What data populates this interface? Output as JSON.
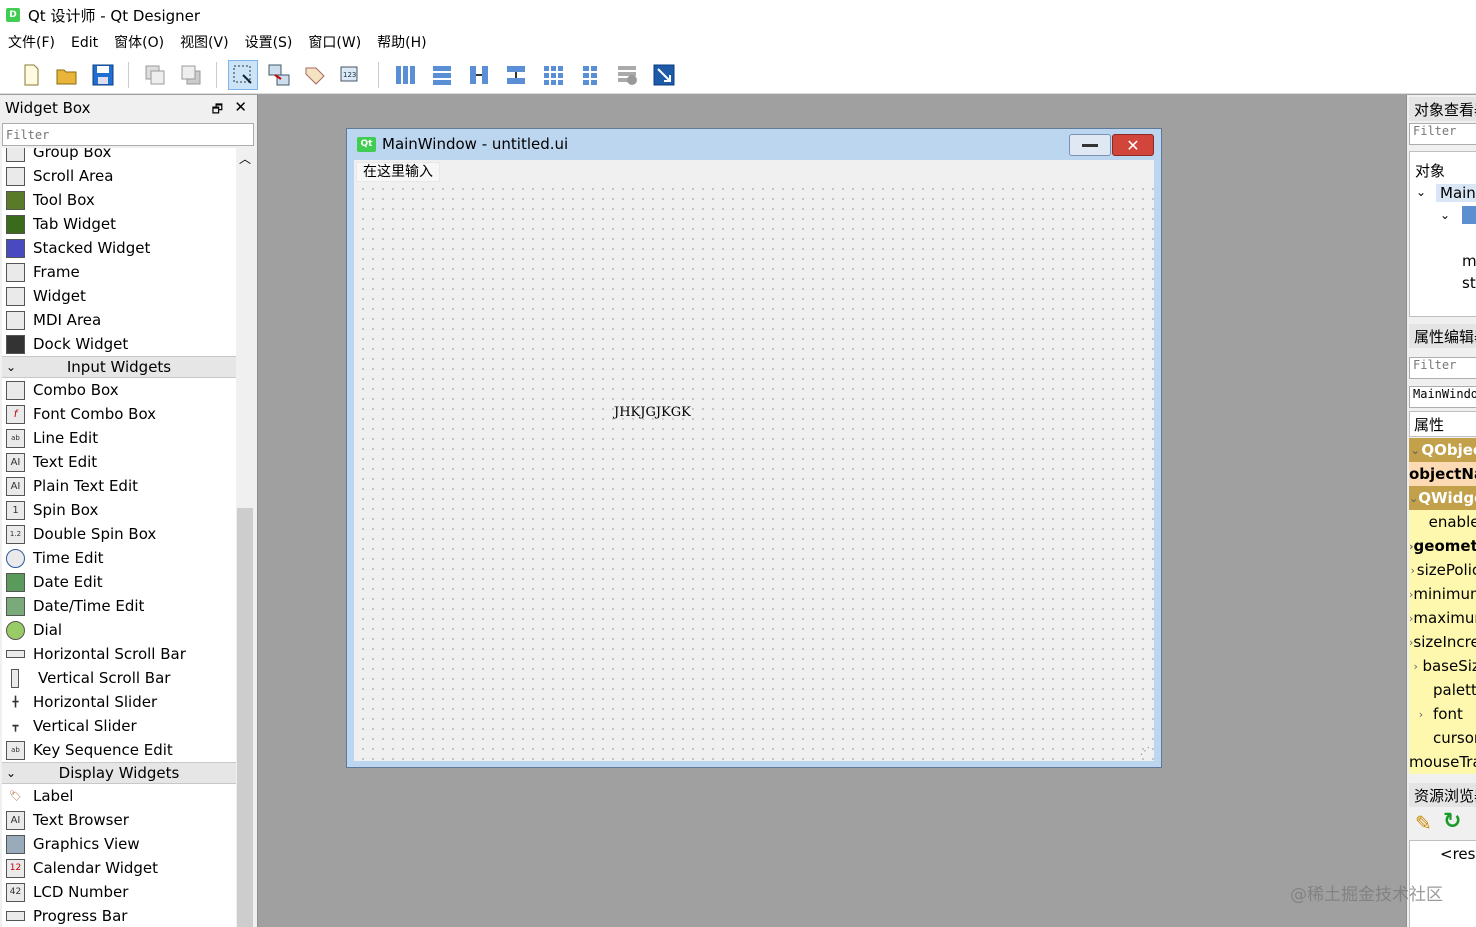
{
  "window": {
    "title": "Qt 设计师 - Qt Designer",
    "app_icon": "D"
  },
  "menubar": [
    "文件(F)",
    "Edit",
    "窗体(O)",
    "视图(V)",
    "设置(S)",
    "窗口(W)",
    "帮助(H)"
  ],
  "toolbar": {
    "icons": [
      "new-file-icon",
      "open-folder-icon",
      "save-icon",
      "send-to-back-icon",
      "bring-to-front-icon",
      "edit-widgets-icon",
      "edit-signals-slots-icon",
      "edit-buddies-icon",
      "edit-tab-order-icon",
      "layout-horizontal-icon",
      "layout-vertical-icon",
      "layout-horizontal-splitter-icon",
      "layout-vertical-splitter-icon",
      "layout-grid-icon",
      "layout-form-icon",
      "break-layout-icon",
      "adjust-size-icon"
    ],
    "active": "edit-widgets-icon"
  },
  "widget_box": {
    "title": "Widget Box",
    "filter_placeholder": "Filter",
    "items_top": [
      "Group Box",
      "Scroll Area",
      "Tool Box",
      "Tab Widget",
      "Stacked Widget",
      "Frame",
      "Widget",
      "MDI Area",
      "Dock Widget"
    ],
    "input_category": "Input Widgets",
    "input_items": [
      "Combo Box",
      "Font Combo Box",
      "Line Edit",
      "Text Edit",
      "Plain Text Edit",
      "Spin Box",
      "Double Spin Box",
      "Time Edit",
      "Date Edit",
      "Date/Time Edit",
      "Dial",
      "Horizontal Scroll Bar",
      "Vertical Scroll Bar",
      "Horizontal Slider",
      "Vertical Slider",
      "Key Sequence Edit"
    ],
    "display_category": "Display Widgets",
    "display_items": [
      "Label",
      "Text Browser",
      "Graphics View",
      "Calendar Widget",
      "LCD Number",
      "Progress Bar"
    ]
  },
  "form_window": {
    "icon": "Qt",
    "title": "MainWindow - untitled.ui",
    "menu_placeholder": "在这里输入",
    "label_text": "JHKJGJKGK"
  },
  "object_inspector": {
    "title": "对象查看器",
    "filter_placeholder": "Filter",
    "header": "对象",
    "rows": [
      "MainWindow",
      "m",
      "st"
    ]
  },
  "property_editor": {
    "title": "属性编辑器",
    "filter_placeholder": "Filter",
    "object_name": "MainWindow",
    "header": "属性",
    "rows": [
      {
        "label": "QObject",
        "type": "group"
      },
      {
        "label": "objectName",
        "type": "qobj-sub"
      },
      {
        "label": "QWidget",
        "type": "group"
      },
      {
        "label": "enabled",
        "type": "qw-sub"
      },
      {
        "label": "geometry",
        "type": "qw-sub-bold"
      },
      {
        "label": "sizePolicy",
        "type": "qw-sub"
      },
      {
        "label": "minimumSize",
        "type": "qw-sub"
      },
      {
        "label": "maximumSize",
        "type": "qw-sub"
      },
      {
        "label": "sizeIncrement",
        "type": "qw-sub"
      },
      {
        "label": "baseSize",
        "type": "qw-sub"
      },
      {
        "label": "palette",
        "type": "qw-sub"
      },
      {
        "label": "font",
        "type": "qw-sub"
      },
      {
        "label": "cursor",
        "type": "qw-sub"
      },
      {
        "label": "mouseTracking",
        "type": "qw-sub"
      }
    ]
  },
  "resource_browser": {
    "title": "资源浏览器",
    "root": "<resource root>"
  },
  "watermark": "@稀土掘金技术社区"
}
